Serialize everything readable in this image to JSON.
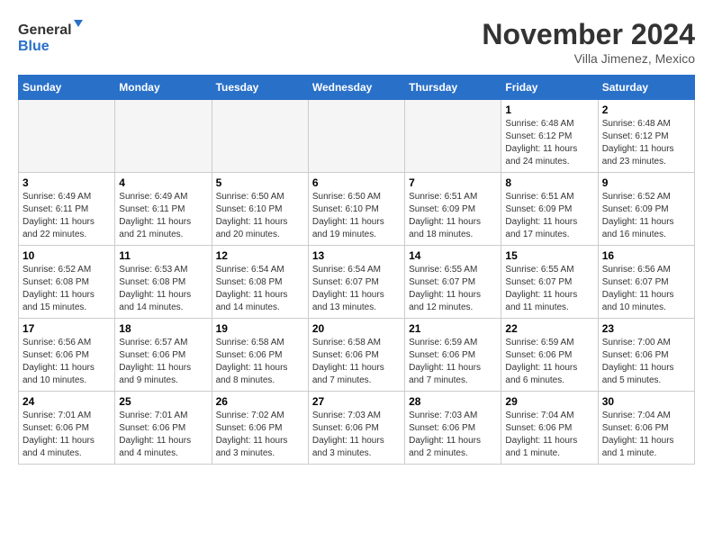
{
  "header": {
    "logo": {
      "general": "General",
      "blue": "Blue"
    },
    "title": "November 2024",
    "subtitle": "Villa Jimenez, Mexico"
  },
  "calendar": {
    "weekdays": [
      "Sunday",
      "Monday",
      "Tuesday",
      "Wednesday",
      "Thursday",
      "Friday",
      "Saturday"
    ],
    "weeks": [
      [
        {
          "day": "",
          "empty": true
        },
        {
          "day": "",
          "empty": true
        },
        {
          "day": "",
          "empty": true
        },
        {
          "day": "",
          "empty": true
        },
        {
          "day": "",
          "empty": true
        },
        {
          "day": "1",
          "sunrise": "Sunrise: 6:48 AM",
          "sunset": "Sunset: 6:12 PM",
          "daylight": "Daylight: 11 hours and 24 minutes."
        },
        {
          "day": "2",
          "sunrise": "Sunrise: 6:48 AM",
          "sunset": "Sunset: 6:12 PM",
          "daylight": "Daylight: 11 hours and 23 minutes."
        }
      ],
      [
        {
          "day": "3",
          "sunrise": "Sunrise: 6:49 AM",
          "sunset": "Sunset: 6:11 PM",
          "daylight": "Daylight: 11 hours and 22 minutes."
        },
        {
          "day": "4",
          "sunrise": "Sunrise: 6:49 AM",
          "sunset": "Sunset: 6:11 PM",
          "daylight": "Daylight: 11 hours and 21 minutes."
        },
        {
          "day": "5",
          "sunrise": "Sunrise: 6:50 AM",
          "sunset": "Sunset: 6:10 PM",
          "daylight": "Daylight: 11 hours and 20 minutes."
        },
        {
          "day": "6",
          "sunrise": "Sunrise: 6:50 AM",
          "sunset": "Sunset: 6:10 PM",
          "daylight": "Daylight: 11 hours and 19 minutes."
        },
        {
          "day": "7",
          "sunrise": "Sunrise: 6:51 AM",
          "sunset": "Sunset: 6:09 PM",
          "daylight": "Daylight: 11 hours and 18 minutes."
        },
        {
          "day": "8",
          "sunrise": "Sunrise: 6:51 AM",
          "sunset": "Sunset: 6:09 PM",
          "daylight": "Daylight: 11 hours and 17 minutes."
        },
        {
          "day": "9",
          "sunrise": "Sunrise: 6:52 AM",
          "sunset": "Sunset: 6:09 PM",
          "daylight": "Daylight: 11 hours and 16 minutes."
        }
      ],
      [
        {
          "day": "10",
          "sunrise": "Sunrise: 6:52 AM",
          "sunset": "Sunset: 6:08 PM",
          "daylight": "Daylight: 11 hours and 15 minutes."
        },
        {
          "day": "11",
          "sunrise": "Sunrise: 6:53 AM",
          "sunset": "Sunset: 6:08 PM",
          "daylight": "Daylight: 11 hours and 14 minutes."
        },
        {
          "day": "12",
          "sunrise": "Sunrise: 6:54 AM",
          "sunset": "Sunset: 6:08 PM",
          "daylight": "Daylight: 11 hours and 14 minutes."
        },
        {
          "day": "13",
          "sunrise": "Sunrise: 6:54 AM",
          "sunset": "Sunset: 6:07 PM",
          "daylight": "Daylight: 11 hours and 13 minutes."
        },
        {
          "day": "14",
          "sunrise": "Sunrise: 6:55 AM",
          "sunset": "Sunset: 6:07 PM",
          "daylight": "Daylight: 11 hours and 12 minutes."
        },
        {
          "day": "15",
          "sunrise": "Sunrise: 6:55 AM",
          "sunset": "Sunset: 6:07 PM",
          "daylight": "Daylight: 11 hours and 11 minutes."
        },
        {
          "day": "16",
          "sunrise": "Sunrise: 6:56 AM",
          "sunset": "Sunset: 6:07 PM",
          "daylight": "Daylight: 11 hours and 10 minutes."
        }
      ],
      [
        {
          "day": "17",
          "sunrise": "Sunrise: 6:56 AM",
          "sunset": "Sunset: 6:06 PM",
          "daylight": "Daylight: 11 hours and 10 minutes."
        },
        {
          "day": "18",
          "sunrise": "Sunrise: 6:57 AM",
          "sunset": "Sunset: 6:06 PM",
          "daylight": "Daylight: 11 hours and 9 minutes."
        },
        {
          "day": "19",
          "sunrise": "Sunrise: 6:58 AM",
          "sunset": "Sunset: 6:06 PM",
          "daylight": "Daylight: 11 hours and 8 minutes."
        },
        {
          "day": "20",
          "sunrise": "Sunrise: 6:58 AM",
          "sunset": "Sunset: 6:06 PM",
          "daylight": "Daylight: 11 hours and 7 minutes."
        },
        {
          "day": "21",
          "sunrise": "Sunrise: 6:59 AM",
          "sunset": "Sunset: 6:06 PM",
          "daylight": "Daylight: 11 hours and 7 minutes."
        },
        {
          "day": "22",
          "sunrise": "Sunrise: 6:59 AM",
          "sunset": "Sunset: 6:06 PM",
          "daylight": "Daylight: 11 hours and 6 minutes."
        },
        {
          "day": "23",
          "sunrise": "Sunrise: 7:00 AM",
          "sunset": "Sunset: 6:06 PM",
          "daylight": "Daylight: 11 hours and 5 minutes."
        }
      ],
      [
        {
          "day": "24",
          "sunrise": "Sunrise: 7:01 AM",
          "sunset": "Sunset: 6:06 PM",
          "daylight": "Daylight: 11 hours and 4 minutes."
        },
        {
          "day": "25",
          "sunrise": "Sunrise: 7:01 AM",
          "sunset": "Sunset: 6:06 PM",
          "daylight": "Daylight: 11 hours and 4 minutes."
        },
        {
          "day": "26",
          "sunrise": "Sunrise: 7:02 AM",
          "sunset": "Sunset: 6:06 PM",
          "daylight": "Daylight: 11 hours and 3 minutes."
        },
        {
          "day": "27",
          "sunrise": "Sunrise: 7:03 AM",
          "sunset": "Sunset: 6:06 PM",
          "daylight": "Daylight: 11 hours and 3 minutes."
        },
        {
          "day": "28",
          "sunrise": "Sunrise: 7:03 AM",
          "sunset": "Sunset: 6:06 PM",
          "daylight": "Daylight: 11 hours and 2 minutes."
        },
        {
          "day": "29",
          "sunrise": "Sunrise: 7:04 AM",
          "sunset": "Sunset: 6:06 PM",
          "daylight": "Daylight: 11 hours and 1 minute."
        },
        {
          "day": "30",
          "sunrise": "Sunrise: 7:04 AM",
          "sunset": "Sunset: 6:06 PM",
          "daylight": "Daylight: 11 hours and 1 minute."
        }
      ]
    ]
  }
}
